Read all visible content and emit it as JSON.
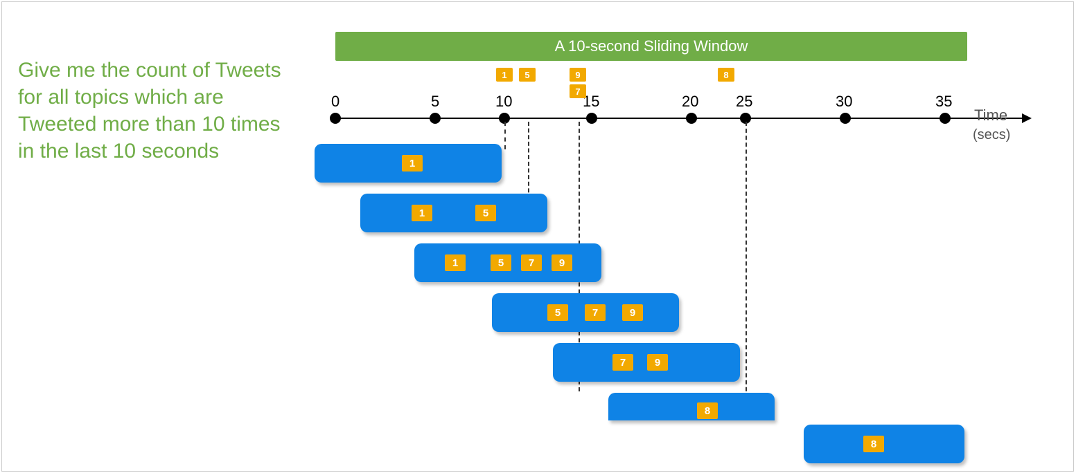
{
  "query_text": "Give me the count of Tweets for all topics which are Tweeted more than 10 times in the last 10 seconds",
  "title_bar": "A 10-second Sliding Window",
  "axis": {
    "title": "Time",
    "units": "(secs)",
    "ticks": [
      "0",
      "5",
      "10",
      "15",
      "20",
      "25",
      "30",
      "35"
    ]
  },
  "events": {
    "e1": "1",
    "e5": "5",
    "e9": "9",
    "e7": "7",
    "e8": "8"
  },
  "windows": [
    {
      "values": [
        "1"
      ]
    },
    {
      "values": [
        "1",
        "5"
      ]
    },
    {
      "values": [
        "1",
        "5",
        "7",
        "9"
      ]
    },
    {
      "values": [
        "5",
        "7",
        "9"
      ]
    },
    {
      "values": [
        "7",
        "9"
      ]
    },
    {
      "values": [
        "8"
      ]
    },
    {
      "values": [
        "8"
      ]
    }
  ]
}
